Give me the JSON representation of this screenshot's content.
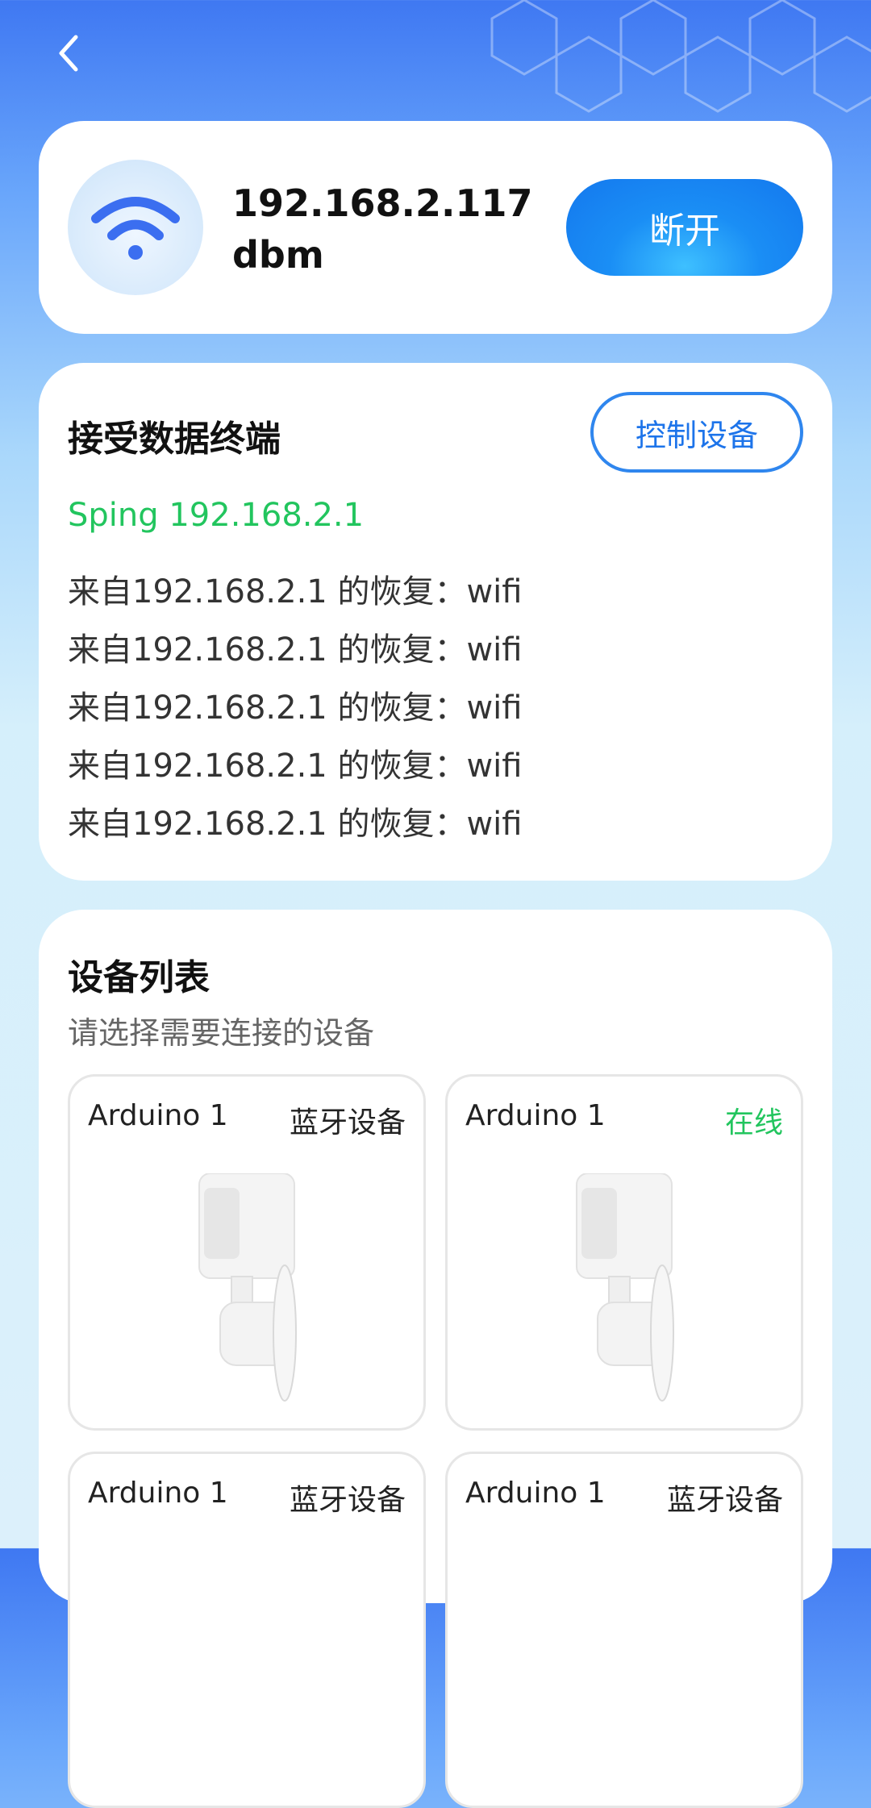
{
  "connection": {
    "ip": "192.168.2.117",
    "signal_unit": "dbm",
    "disconnect_label": "断开",
    "icon": "wifi-icon"
  },
  "terminal": {
    "title": "接受数据终端",
    "control_label": "控制设备",
    "ping_line": "Sping 192.168.2.1",
    "ping_color": "#22c55e",
    "replies": [
      "来自192.168.2.1 的恢复：wifi",
      "来自192.168.2.1 的恢复：wifi",
      "来自192.168.2.1 的恢复：wifi",
      "来自192.168.2.1 的恢复：wifi",
      "来自192.168.2.1 的恢复：wifi"
    ]
  },
  "devices": {
    "title": "设备列表",
    "subtitle": "请选择需要连接的设备",
    "items": [
      {
        "name": "Arduino 1",
        "status": "蓝牙设备",
        "online": false
      },
      {
        "name": "Arduino 1",
        "status": "在线",
        "online": true
      },
      {
        "name": "Arduino 1",
        "status": "蓝牙设备",
        "online": false
      },
      {
        "name": "Arduino 1",
        "status": "蓝牙设备",
        "online": false
      }
    ]
  },
  "colors": {
    "accent": "#1a8ef5",
    "online": "#22c55e"
  }
}
